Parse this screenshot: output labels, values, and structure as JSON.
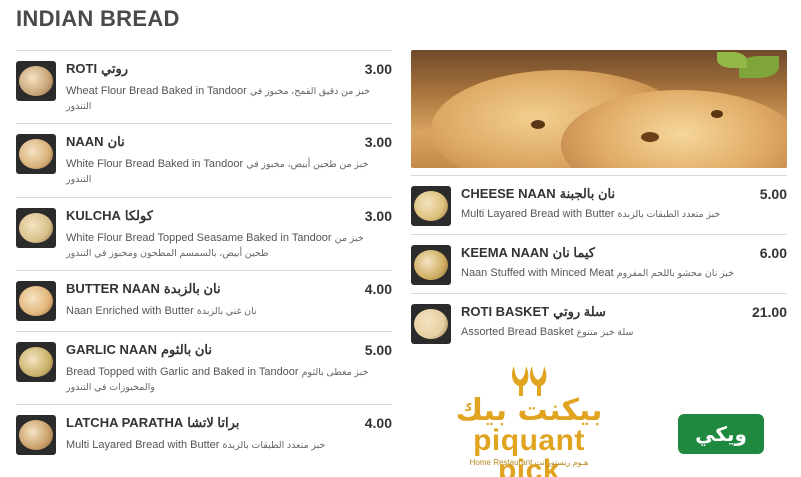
{
  "title": "INDIAN BREAD",
  "left_items": [
    {
      "name": "ROTI",
      "name_ar": "روتي",
      "price": "3.00",
      "desc": "Wheat Flour Bread Baked in Tandoor",
      "desc_ar": "خبز من دقيق القمح، مخبوز في التندور",
      "food_color": "#c8a578"
    },
    {
      "name": "NAAN",
      "name_ar": "نان",
      "price": "3.00",
      "desc": "White Flour Bread Baked in Tandoor",
      "desc_ar": "خبز من طحين أبيض، مخبوز في التندور",
      "food_color": "#d9b07a"
    },
    {
      "name": "KULCHA",
      "name_ar": "كولكا",
      "price": "3.00",
      "desc": "White Flour Bread Topped Seasame Baked in Tandoor",
      "desc_ar": "خبز من طحين أبيض، بالسمسم المطحون ومخبوز في التندور",
      "food_color": "#d8c08a"
    },
    {
      "name": "BUTTER NAAN",
      "name_ar": "نان بالزبدة",
      "price": "4.00",
      "desc": "Naan Enriched with Butter",
      "desc_ar": "نان غني بالزبدة",
      "food_color": "#e2b57a"
    },
    {
      "name": "GARLIC NAAN",
      "name_ar": "نان بالثوم",
      "price": "5.00",
      "desc": "Bread Topped with Garlic and Baked in Tandoor",
      "desc_ar": "خبز مغطى بالثوم والمخبوزات في التندور",
      "food_color": "#c9b26a"
    },
    {
      "name": "LATCHA PARATHA",
      "name_ar": "براتا لاتشا",
      "price": "4.00",
      "desc": "Multi Layared Bread with Butter",
      "desc_ar": "خبز متعدد الطبقات بالزبدة",
      "food_color": "#caa06a"
    }
  ],
  "right_items": [
    {
      "name": "CHEESE NAAN",
      "name_ar": "نان بالجبنة",
      "price": "5.00",
      "desc": "Multi Layared Bread with Butter",
      "desc_ar": "خبز متعدد الطبقات بالزبدة",
      "food_color": "#dcc07a"
    },
    {
      "name": "KEEMA NAAN",
      "name_ar": "كيما نان",
      "price": "6.00",
      "desc": "Naan Stuffed with Minced Meat",
      "desc_ar": "خبز نان محشو باللحم المفروم",
      "food_color": "#cfae62"
    },
    {
      "name": "ROTI BASKET",
      "name_ar": "سلة روتي",
      "price": "21.00",
      "desc": "Assorted Bread Basket",
      "desc_ar": "سلة خبز متنوع",
      "food_color": "#e6cfa2"
    }
  ],
  "logo_piquant": {
    "ar": "بيكنت بيك",
    "en": "piquant pick",
    "sub": "Home Restaurant هـوم ريستورانت"
  },
  "logo_wiki": {
    "text": "ويكي"
  },
  "colors": {
    "accent": "#e0a420",
    "wiki_green": "#1f8a3f",
    "thumb_bg": "#2b2b2b"
  }
}
